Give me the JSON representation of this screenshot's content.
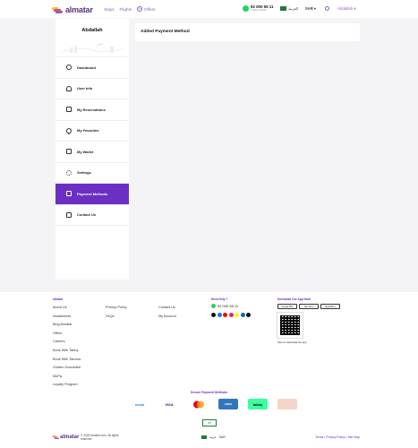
{
  "header": {
    "logo": "almatar",
    "nav": [
      "Stays",
      "Flights",
      "Offers"
    ],
    "phone": "92 000 55 11",
    "phone_sub": "7 Days a Week",
    "language": "العربية",
    "currency": "SAR",
    "user": "Abdallah"
  },
  "sidebar": {
    "name": "Abdallah",
    "items": [
      {
        "label": "Dashboard",
        "icon": "clock-icon"
      },
      {
        "label": "User Info",
        "icon": "user-icon"
      },
      {
        "label": "My Reservations",
        "icon": "calendar-icon"
      },
      {
        "label": "My Favorites",
        "icon": "heart-icon"
      },
      {
        "label": "My Wallet",
        "icon": "wallet-icon"
      },
      {
        "label": "Settings",
        "icon": "gear-icon"
      },
      {
        "label": "Payment Methods",
        "icon": "card-icon",
        "active": true
      },
      {
        "label": "Contact Us",
        "icon": "mail-icon"
      }
    ]
  },
  "main": {
    "title": "Added Payment Method"
  },
  "footer": {
    "col1": {
      "head": "almatar",
      "links": [
        "About Us",
        "Installments",
        "Blog Almatar",
        "Offers",
        "Careers",
        "Book With Tabby",
        "Book With Tamara",
        "Golden Guarantee",
        "MoFly",
        "Loyalty Program"
      ]
    },
    "col2": {
      "links": [
        "Privacy Policy",
        "FAQs"
      ]
    },
    "col3": {
      "links": [
        "Contact Us",
        "My Account"
      ]
    },
    "help": {
      "head": "Need Help ?",
      "phone": "92 000 55 11"
    },
    "app": {
      "head": "Download Our App Now!",
      "stores": [
        "Google Play",
        "App Store",
        "AppGallery"
      ],
      "scan": "Scan to download the app"
    },
    "payments_title": "Secure Payment Methods",
    "payments": [
      "mada",
      "VISA",
      "AMEX",
      "tabby",
      "tamara"
    ],
    "copyright": "© 2025 Almatar.com. All rights reserved",
    "bottom_lang": "عربية",
    "bottom_currency": "SAR",
    "terms": "Terms • Privacy Policy • Site Map"
  },
  "colors": {
    "brand_purple": "#6b2fc4",
    "logo_purple": "#5a2e86",
    "accent_yellow": "#f6c21a",
    "accent_pink": "#e64686"
  }
}
